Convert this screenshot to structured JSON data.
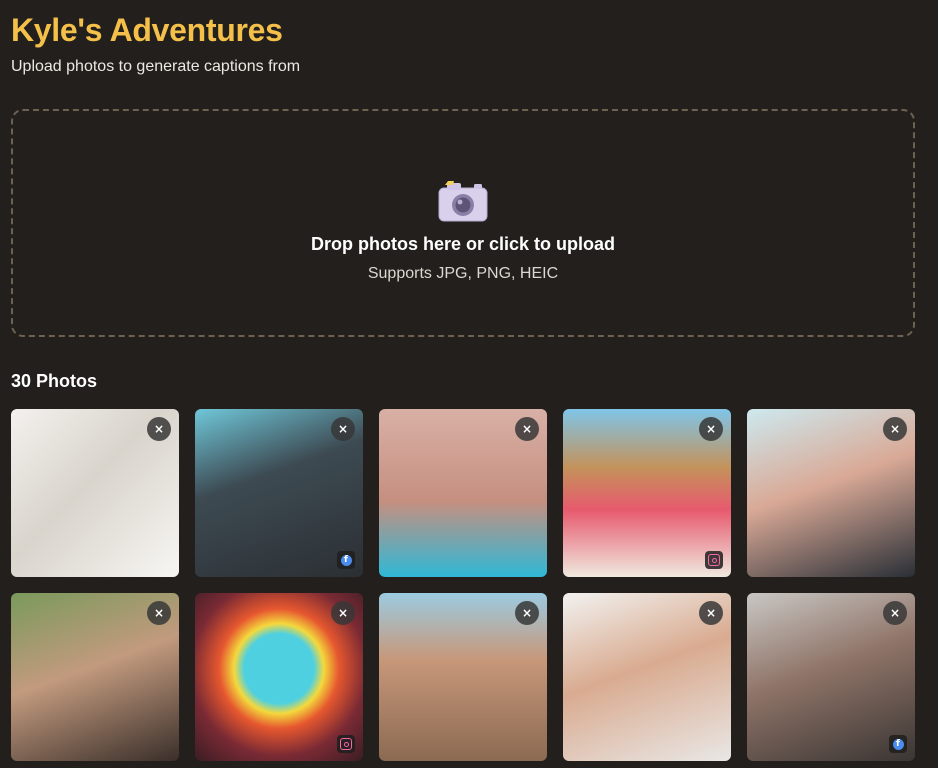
{
  "header": {
    "title": "Kyle's Adventures",
    "subtitle": "Upload photos to generate captions from"
  },
  "dropzone": {
    "icon": "camera-icon",
    "title": "Drop photos here or click to upload",
    "subtitle": "Supports JPG, PNG, HEIC"
  },
  "gallery": {
    "count_label": "30 Photos",
    "remove_glyph": "×",
    "photos": [
      {
        "bg": "linear-gradient(135deg,#f3f1ee 0%,#d9d4cc 45%,#f7f6f3 100%)",
        "social": ""
      },
      {
        "bg": "linear-gradient(160deg,#6fc7d9 0%,#3d4a52 40%,#2b2f33 100%)",
        "social": "facebook"
      },
      {
        "bg": "linear-gradient(180deg,#d9b0a6 0%,#c58f80 55%,#2fb8d6 100%)",
        "social": ""
      },
      {
        "bg": "linear-gradient(180deg,#7fc5e8 0%,#c4925a 35%,#e75a6e 60%,#f0e9df 100%)",
        "social": "instagram"
      },
      {
        "bg": "linear-gradient(160deg,#cde9ef 0%,#d9a996 45%,#2a2f36 100%)",
        "social": ""
      },
      {
        "bg": "linear-gradient(160deg,#7a9a5c 0%,#c29a7e 45%,#3a2f2a 100%)",
        "social": ""
      },
      {
        "bg": "radial-gradient(circle at 50% 45%,#4fd0e0 0%,#4fd0e0 28%,#f4d93c 36%,#e6572f 48%,#7a2a34 70%,#3a1d24 100%)",
        "social": "instagram"
      },
      {
        "bg": "linear-gradient(180deg,#9ccbe0 0%,#c79779 40%,#8b6a52 100%)",
        "social": ""
      },
      {
        "bg": "linear-gradient(160deg,#f2f2f0 0%,#d9ab90 45%,#e9e7e5 100%)",
        "social": ""
      },
      {
        "bg": "linear-gradient(160deg,#c9c7c4 0%,#8f7468 45%,#3a3533 100%)",
        "social": "facebook"
      }
    ]
  }
}
